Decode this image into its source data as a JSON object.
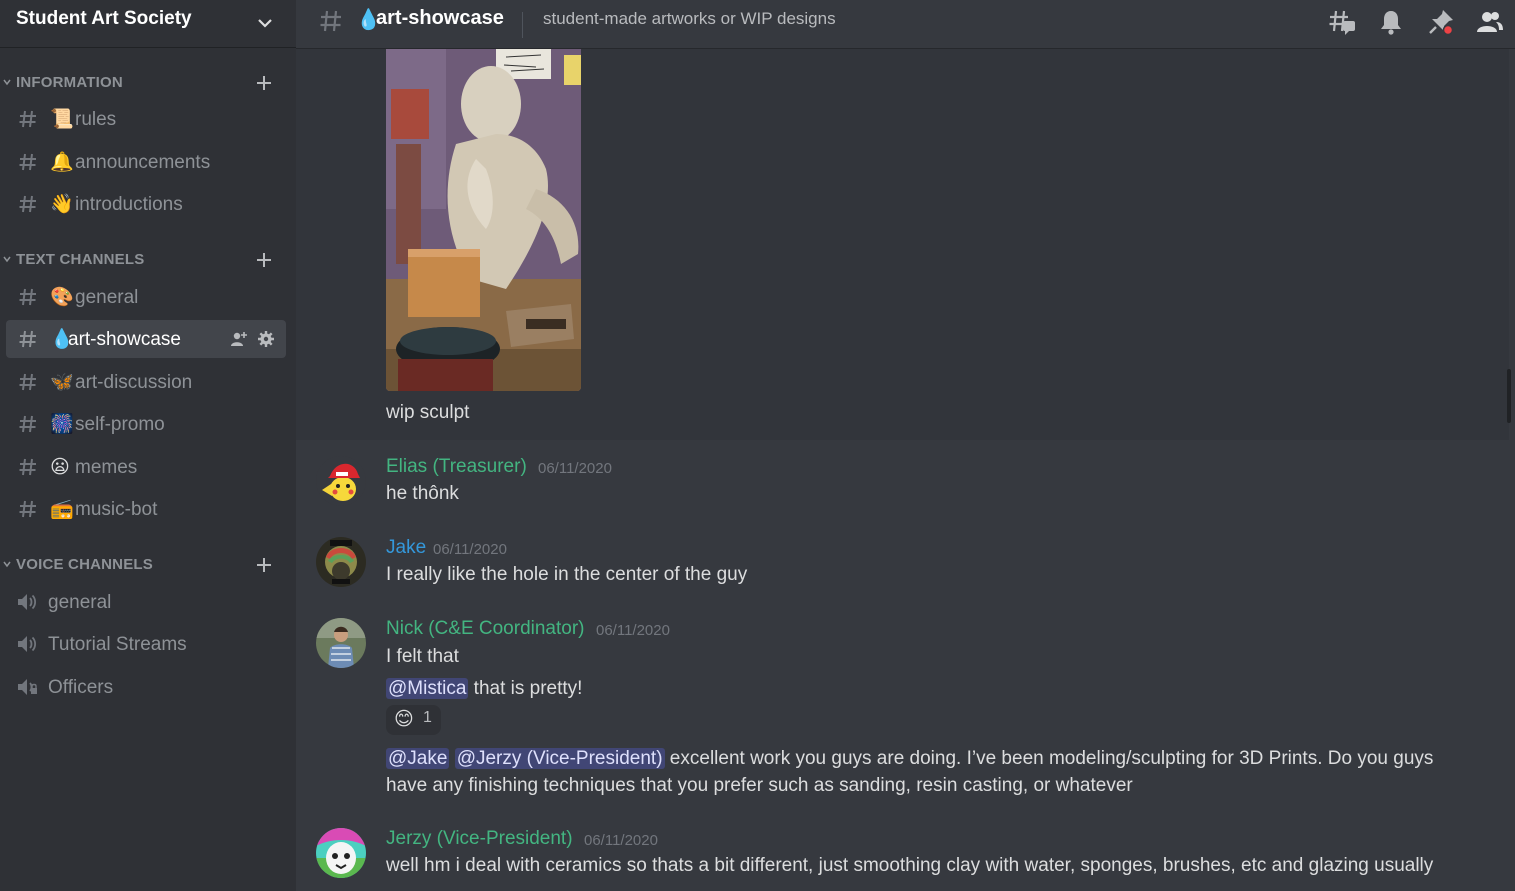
{
  "server": {
    "name": "Student Art Society"
  },
  "sidebar": {
    "categories": [
      {
        "label": "INFORMATION",
        "channels": [
          {
            "emoji": "📜",
            "label": "rules"
          },
          {
            "emoji": "🔔",
            "label": "announcements"
          },
          {
            "emoji": "👋",
            "label": "introductions"
          }
        ]
      },
      {
        "label": "TEXT CHANNELS",
        "channels": [
          {
            "emoji": "🎨",
            "label": "general"
          },
          {
            "emoji": "💧",
            "label": "art-showcase",
            "active": true
          },
          {
            "emoji": "🦋",
            "label": "art-discussion"
          },
          {
            "emoji": "🎆",
            "label": "self-promo"
          },
          {
            "emoji": "😦",
            "label": "memes"
          },
          {
            "emoji": "📻",
            "label": "music-bot"
          }
        ]
      },
      {
        "label": "VOICE CHANNELS",
        "channels": [
          {
            "label": "general"
          },
          {
            "label": "Tutorial Streams"
          },
          {
            "label": "Officers"
          }
        ]
      }
    ]
  },
  "topbar": {
    "channel_emoji": "💧",
    "channel_name": "art-showcase",
    "topic": "student-made artworks or WIP designs",
    "icons": [
      "threads-icon",
      "bell-icon",
      "pin-icon",
      "members-icon"
    ]
  },
  "messages": [
    {
      "text": "wip sculpt",
      "attachment": "wip sculpture photo"
    },
    {
      "author": "Elias (Treasurer)",
      "timestamp": "06/11/2020",
      "author_color": "#43b581",
      "lines": [
        "he thônk"
      ]
    },
    {
      "author": "Jake",
      "timestamp": "06/11/2020",
      "author_color": "#3498db",
      "lines": [
        "I really like the hole in the center of the guy"
      ]
    },
    {
      "author": "Nick (C&E Coordinator)",
      "timestamp": "06/11/2020",
      "author_color": "#43b581",
      "lines": [
        "I felt that"
      ],
      "mention_line": {
        "mention": "@Mistica",
        "text": " that is pretty!"
      },
      "reaction": {
        "emoji": "😊",
        "count": "1"
      },
      "mention_line2": {
        "mention1": "@Jake",
        "mention2": "@Jerzy (Vice-President)",
        "text": " excellent work you guys are doing. I’ve been modeling/sculpting for 3D Prints. Do you guys",
        "text2": "have any finishing techniques that you prefer such as sanding, resin casting, or whatever"
      }
    },
    {
      "author": "Jerzy (Vice-President)",
      "timestamp": "06/11/2020",
      "author_color": "#43b581",
      "lines": [
        "well hm i deal with ceramics so thats a bit different, just smoothing clay with water, sponges, brushes, etc and glazing usually"
      ]
    }
  ]
}
